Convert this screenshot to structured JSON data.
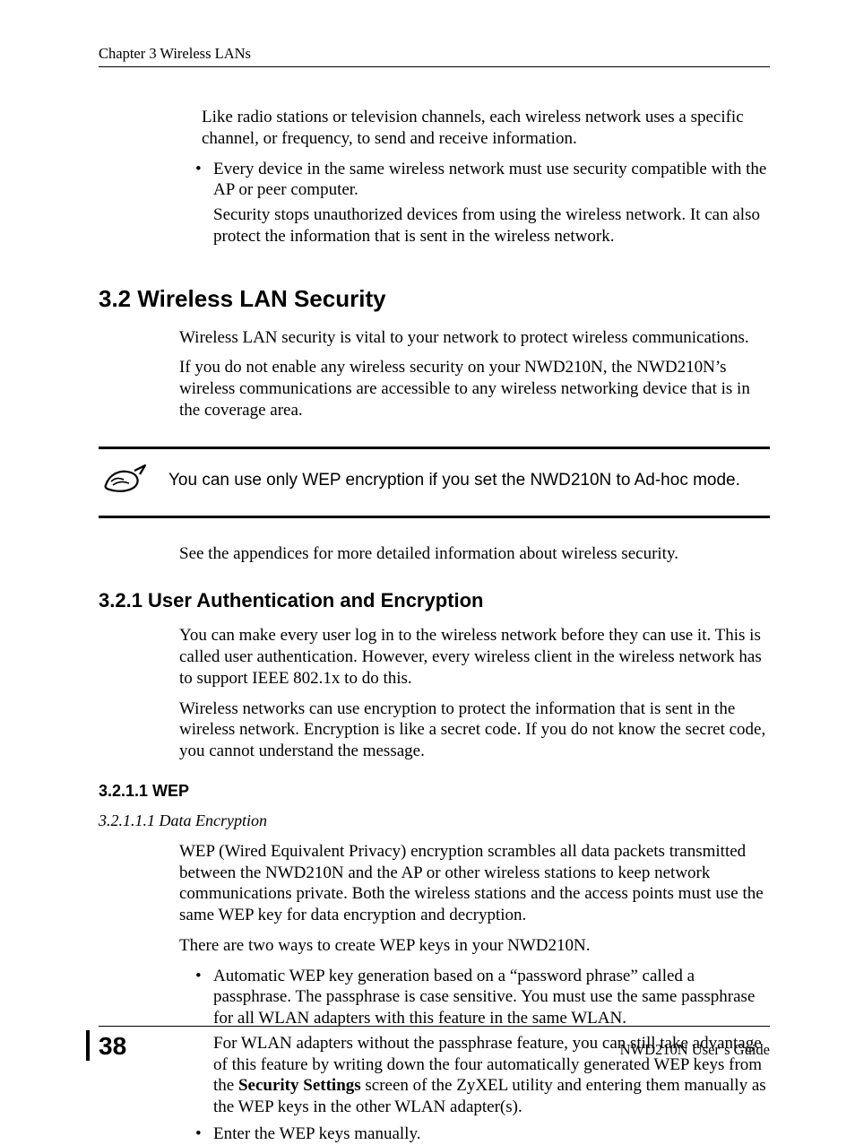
{
  "header": {
    "running_head": "Chapter 3 Wireless LANs"
  },
  "intro": {
    "para_channel": "Like radio stations or television channels, each wireless network uses a specific channel, or frequency, to send and receive information.",
    "bullet_security_a": "Every device in the same wireless network must use security compatible with the AP or peer computer.",
    "bullet_security_b": "Security stops unauthorized devices from using the wireless network. It can also protect the information that is sent in the wireless network."
  },
  "sec32": {
    "heading": "3.2  Wireless LAN Security",
    "p1": "Wireless LAN security is vital to your network to protect wireless communications.",
    "p2": "If you do not enable any wireless security on your NWD210N, the NWD210N’s wireless communications are accessible to any wireless networking device that is in the coverage area.",
    "note": "You can use only WEP encryption if you set the NWD210N to Ad-hoc mode.",
    "p3": "See the appendices for more detailed information about wireless security."
  },
  "sec321": {
    "heading": "3.2.1  User Authentication and Encryption",
    "p1": "You can make every user log in to the wireless network before they can use it. This is called user authentication. However, every wireless client in the wireless network has to support IEEE 802.1x to do this.",
    "p2": "Wireless networks can use encryption to protect the information that is sent in the wireless network. Encryption is like a secret code. If you do not know the secret code, you cannot understand the message."
  },
  "sec3211": {
    "heading": "3.2.1.1  WEP"
  },
  "sec32111": {
    "heading": "3.2.1.1.1  Data Encryption",
    "p1": "WEP (Wired Equivalent Privacy) encryption scrambles all data packets transmitted between the NWD210N and the AP or other wireless stations to keep network communications private. Both the wireless stations and the access points must use the same WEP key for data encryption and decryption.",
    "p2": "There are two ways to create WEP keys in your NWD210N.",
    "bullet1_a": "Automatic WEP key generation based on a “password phrase” called a passphrase. The passphrase is case sensitive. You must use the same passphrase for all WLAN adapters with this feature in the same WLAN.",
    "bullet1_b_pre": "For WLAN adapters without the passphrase feature, you can still take advantage of this feature by writing down the four automatically generated WEP keys from the ",
    "bullet1_b_bold": "Security Settings",
    "bullet1_b_post": " screen of the ZyXEL utility and entering them manually as the WEP keys in the other WLAN adapter(s).",
    "bullet2": "Enter the WEP keys manually."
  },
  "footer": {
    "page": "38",
    "guide": "NWD210N User’s Guide"
  }
}
